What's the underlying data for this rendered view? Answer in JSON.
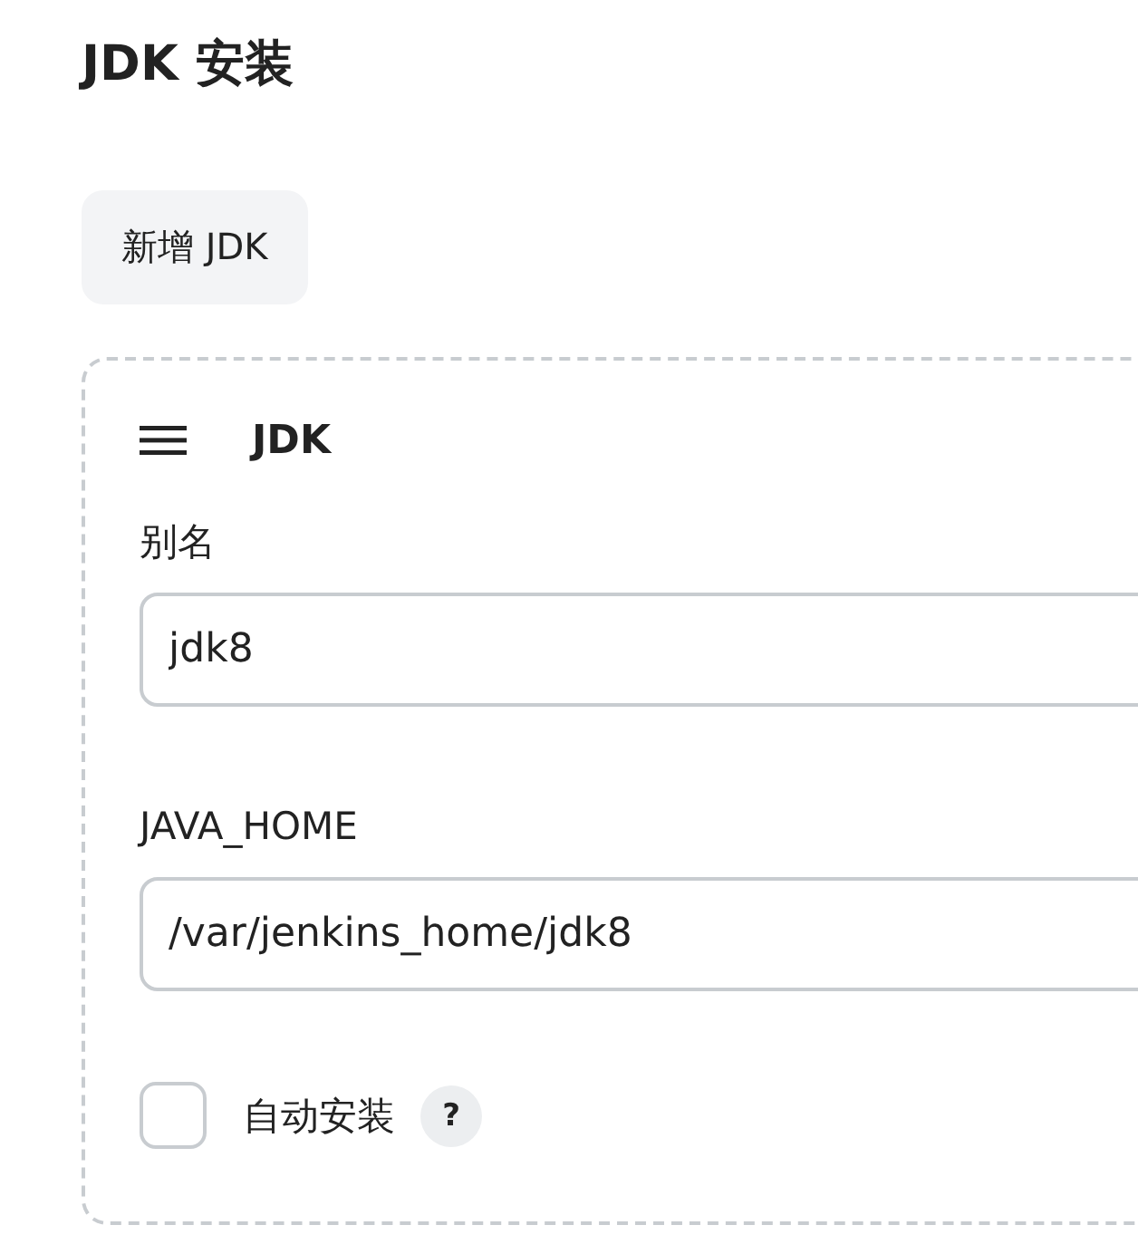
{
  "title": "JDK 安装",
  "add_button": "新增 JDK",
  "card": {
    "heading": "JDK",
    "fields": [
      {
        "label": "别名",
        "value": "jdk8"
      },
      {
        "label": "JAVA_HOME",
        "value": "/var/jenkins_home/jdk8"
      }
    ],
    "checkbox": {
      "label": "自动安装",
      "checked": false,
      "help": "?"
    }
  }
}
